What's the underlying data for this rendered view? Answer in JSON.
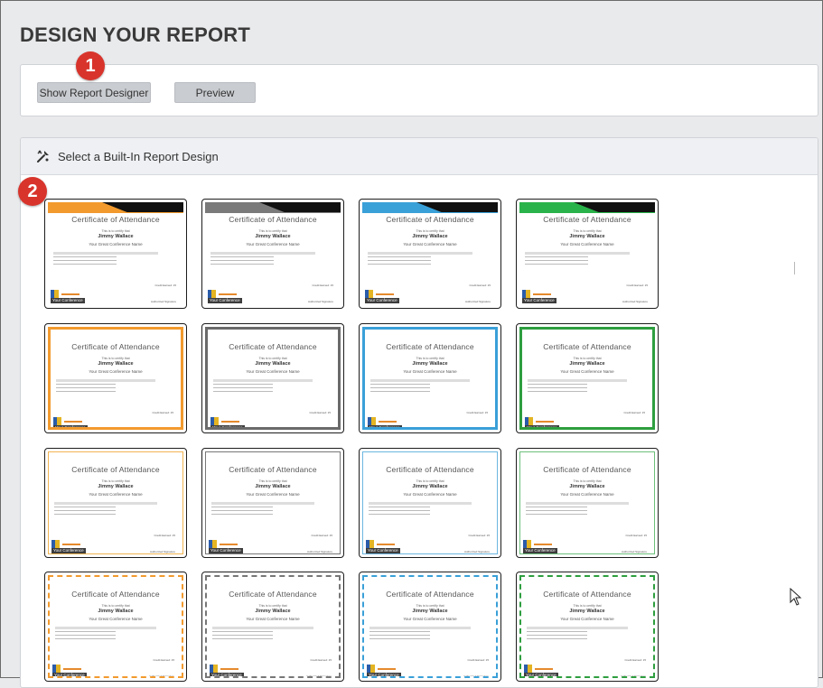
{
  "page_title": "DESIGN YOUR REPORT",
  "toolbar": {
    "show_designer_label": "Show Report Designer",
    "preview_label": "Preview"
  },
  "annotations": {
    "badge_1": "1",
    "badge_2": "2"
  },
  "designs": {
    "header_label": "Select a Built-In Report Design",
    "header_icon": "design-tools-icon",
    "certificate": {
      "title": "Certificate of Attendance",
      "certifies": "This is to certify that",
      "name": "Jimmy Wallace",
      "conference": "Your Great Conference Name",
      "credit": "Credit Earned: 15",
      "signature": "Authorized Signature",
      "logo_text": "Your Conference"
    },
    "rows": [
      {
        "style": "banner",
        "colors": [
          "#f29a2e",
          "#7a7a7a",
          "#3aa0d8",
          "#2ab34a"
        ]
      },
      {
        "style": "thick-border",
        "colors": [
          "#f29a2e",
          "#6a6a6a",
          "#3aa0d8",
          "#2e9e3f"
        ]
      },
      {
        "style": "thin-border",
        "colors": [
          "#f2b451",
          "#777777",
          "#6bb6e0",
          "#6cc07a"
        ]
      },
      {
        "style": "dashed-border",
        "colors": [
          "#f29a2e",
          "#777777",
          "#3aa0d8",
          "#2e9e3f"
        ]
      }
    ]
  },
  "colors": {
    "badge": "#d8342c",
    "button": "#c9ccd0",
    "panel_header": "#eef0f3"
  }
}
